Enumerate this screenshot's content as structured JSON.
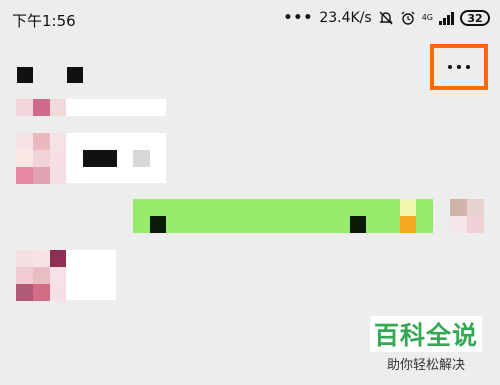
{
  "status_bar": {
    "time": "下午1:56",
    "speed": "23.4K/s",
    "network": "4G",
    "battery": "32"
  },
  "header": {
    "more_label": "..."
  },
  "watermark": {
    "title": "百科全说",
    "subtitle": "助你轻松解决"
  }
}
